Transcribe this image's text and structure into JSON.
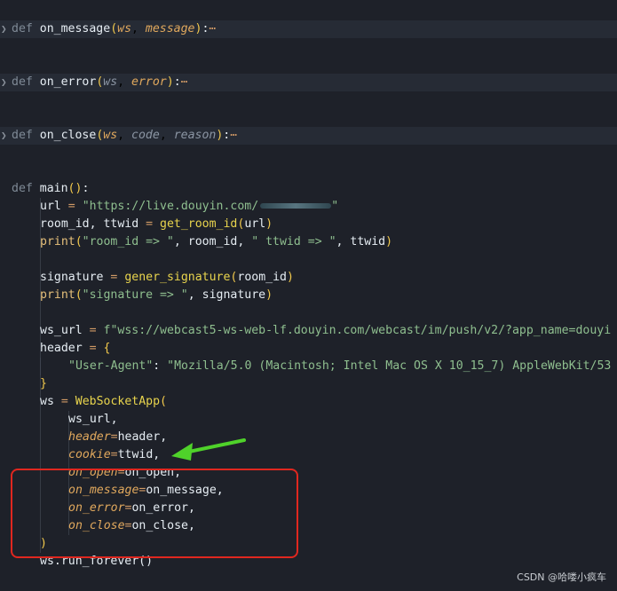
{
  "code": {
    "on_message_keyword": "def",
    "on_message_name": "on_message",
    "on_message_param1": "ws",
    "on_message_param2": "message",
    "on_error_keyword": "def",
    "on_error_name": "on_error",
    "on_error_param1": "ws",
    "on_error_param2": "error",
    "on_close_keyword": "def",
    "on_close_name": "on_close",
    "on_close_param1": "ws",
    "on_close_param2": "code",
    "on_close_param3": "reason",
    "main_keyword": "def",
    "main_name": "main",
    "url_var": "url",
    "url_value_prefix": "\"https://live.douyin.com/",
    "url_value_suffix": "\"",
    "room_line_vars": "room_id, ttwid",
    "room_line_call": "get_room_id",
    "room_line_arg": "url",
    "print1_call": "print",
    "print1_str1": "\"room_id => \"",
    "print1_arg1": "room_id",
    "print1_str2": "\" ttwid => \"",
    "print1_arg2": "ttwid",
    "signature_var": "signature",
    "signature_call": "gener_signature",
    "signature_arg": "room_id",
    "print2_call": "print",
    "print2_str": "\"signature => \"",
    "print2_arg": "signature",
    "ws_url_var": "ws_url",
    "ws_url_value": "f\"wss://webcast5-ws-web-lf.douyin.com/webcast/im/push/v2/?app_name=douyi",
    "header_var": "header",
    "ua_key": "\"User-Agent\"",
    "ua_value": "\"Mozilla/5.0 (Macintosh; Intel Mac OS X 10_15_7) AppleWebKit/53",
    "ws_var": "ws",
    "ws_call": "WebSocketApp",
    "arg_ws_url": "ws_url,",
    "kw_header": "header",
    "kw_header_val": "header,",
    "kw_cookie": "cookie",
    "kw_cookie_val": "ttwid,",
    "kw_on_open": "on_open",
    "kw_on_open_val": "on_open,",
    "kw_on_message": "on_message",
    "kw_on_message_val": "on_message,",
    "kw_on_error": "on_error",
    "kw_on_error_val": "on_error,",
    "kw_on_close": "on_close",
    "kw_on_close_val": "on_close,",
    "run_forever": "ws.run_forever()"
  },
  "watermark": "CSDN @哈喽小疯车",
  "colors": {
    "highlight_box": "#e0271f",
    "arrow": "#4fd22a"
  }
}
